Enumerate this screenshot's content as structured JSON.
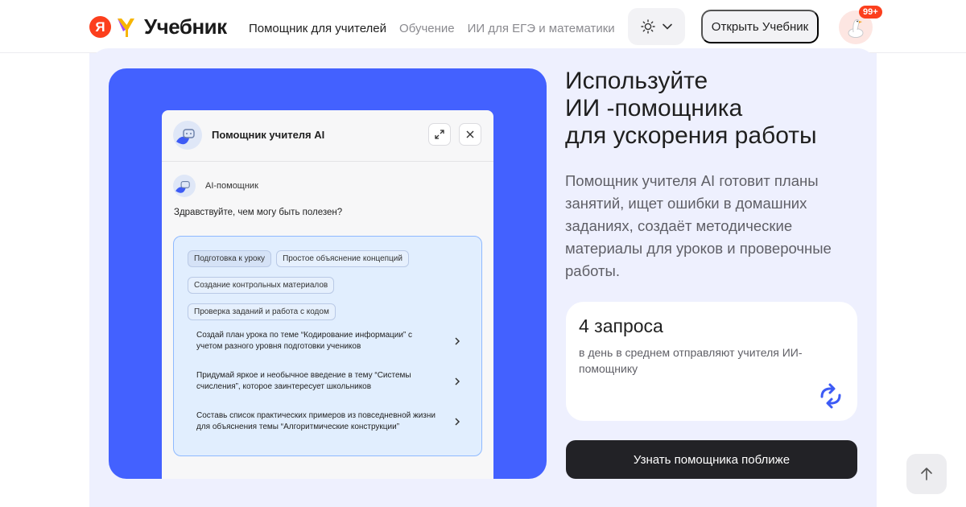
{
  "header": {
    "logo_letter": "Я",
    "logo_text": "Учебник",
    "nav": [
      {
        "label": "Помощник для учителей"
      },
      {
        "label": "Обучение"
      },
      {
        "label": "ИИ для ЕГЭ и математики"
      }
    ],
    "theme_icon": "sun-icon",
    "open_button": "Открыть Учебник",
    "notifications_badge": "99+"
  },
  "mockup": {
    "title": "Помощник учителя AI",
    "assistant_name": "AI-помощник",
    "greeting": "Здравствуйте, чем могу быть полезен?",
    "chips": [
      "Подготовка к уроку",
      "Простое объяснение концепций",
      "Создание контрольных материалов",
      "Проверка заданий и работа с кодом"
    ],
    "prompts": [
      "Создай план урока по теме “Кодирование информации” с учетом разного уровня подготовки учеников",
      "Придумай яркое и необычное введение в тему “Системы счисления”, которое заинтересует школьников",
      "Составь список практических примеров из повседневной жизни для объяснения темы “Алгоритмические конструкции”"
    ]
  },
  "hero": {
    "heading": "Используйте ИИ -помощника для ускорения работы",
    "heading_lines": [
      "Используйте",
      "ИИ -помощника",
      "для ускорения работы"
    ],
    "lead": "Помощник учителя AI готовит планы занятий, ищет ошибки в домашних заданиях, создаёт методические материалы для уроков и проверочные работы."
  },
  "stat": {
    "value": "4 запроса",
    "description": "в день в среднем отправляют учителя ИИ-помощнику"
  },
  "cta_label": "Узнать помощника поближе",
  "colors": {
    "accent_blue": "#4361ff",
    "brand_red": "#fc3f1d",
    "section_bg": "#eef0fe"
  }
}
